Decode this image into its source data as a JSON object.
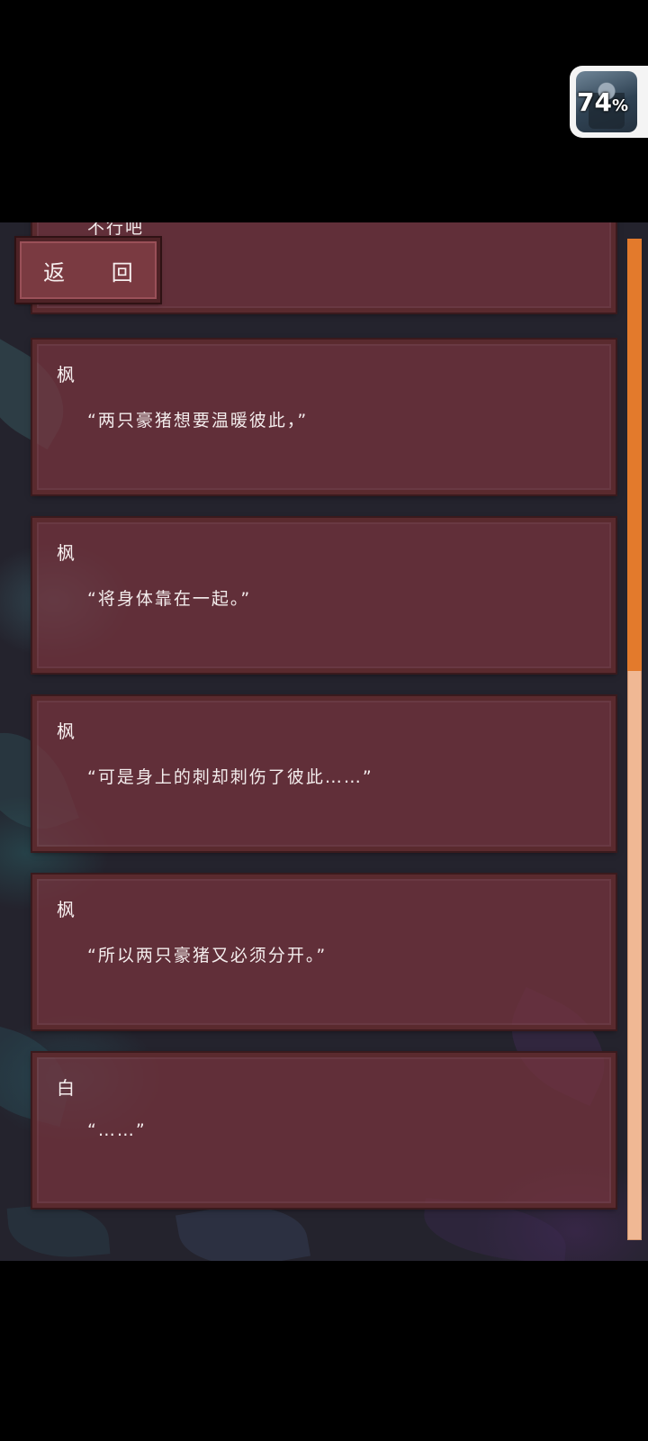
{
  "badge": {
    "percent": "74",
    "unit": "%"
  },
  "back_button": {
    "label": "返 回"
  },
  "top_partial_text": "不行吧",
  "log_entries": [
    {
      "speaker": "枫",
      "line": "“两只豪猪想要温暖彼此，”"
    },
    {
      "speaker": "枫",
      "line": "“将身体靠在一起。”"
    },
    {
      "speaker": "枫",
      "line": "“可是身上的刺却刺伤了彼此……”"
    },
    {
      "speaker": "枫",
      "line": "“所以两只豪猪又必须分开。”"
    },
    {
      "speaker": "白",
      "line": "“……”"
    }
  ],
  "scroll": {
    "position_fraction": 0.43
  },
  "colors": {
    "card_bg": "#78343e",
    "card_border": "#5a2a2e",
    "scroll_thumb": "#e37a2c",
    "scroll_track": "#f0b894"
  }
}
